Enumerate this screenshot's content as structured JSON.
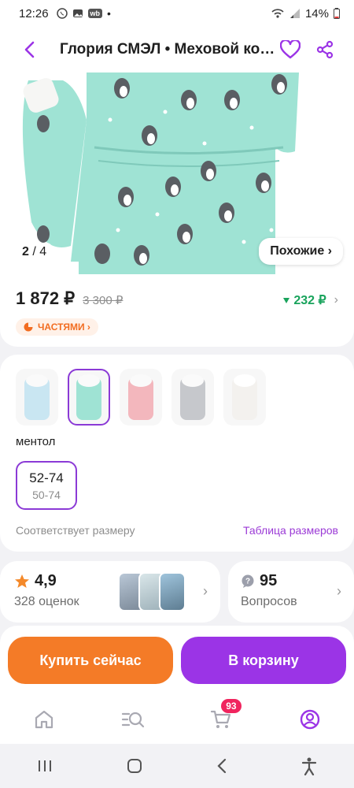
{
  "status_bar": {
    "time": "12:26",
    "battery": "14%"
  },
  "header": {
    "title": "Глория СМЭЛ • Меховой конверт"
  },
  "gallery": {
    "counter_current": "2",
    "counter_total": "/ 4",
    "similar_label": "Похожие ›"
  },
  "price": {
    "current": "1 872 ₽",
    "old": "3 300 ₽",
    "cashback": "232 ₽",
    "installments": "ЧАСТЯМИ ›"
  },
  "variants": {
    "selected_color": "ментол",
    "colors": [
      {
        "name": "blue",
        "color": "#c9e6f2"
      },
      {
        "name": "mint",
        "color": "#9fe3d4"
      },
      {
        "name": "pink",
        "color": "#f3b7bd"
      },
      {
        "name": "grey",
        "color": "#c6c8cc"
      },
      {
        "name": "white",
        "color": "#f3f1ee"
      }
    ],
    "size_main": "52-74",
    "size_sub": "50-74",
    "fit_text": "Соответствует размеру",
    "size_table": "Таблица размеров"
  },
  "reviews": {
    "rating": "4,9",
    "count": "328 оценок"
  },
  "questions": {
    "count": "95",
    "label": "Вопросов"
  },
  "actions": {
    "buy_now": "Купить сейчас",
    "add_to_cart": "В корзину"
  },
  "tab_bar": {
    "cart_badge": "93"
  },
  "colors": {
    "accent": "#9b34e6",
    "buy": "#f47b27",
    "cashback": "#19a35c",
    "mint": "#9fe3d4"
  }
}
